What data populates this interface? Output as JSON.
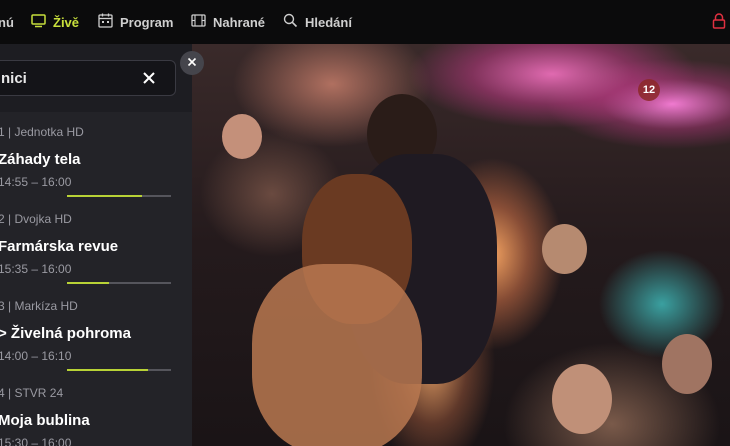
{
  "nav": {
    "items": [
      {
        "label": "nú",
        "icon": "menu-icon",
        "active": false
      },
      {
        "label": "Živě",
        "icon": "tv-icon",
        "active": true
      },
      {
        "label": "Program",
        "icon": "calendar-icon",
        "active": false
      },
      {
        "label": "Nahrané",
        "icon": "film-icon",
        "active": false
      },
      {
        "label": "Hledání",
        "icon": "search-icon",
        "active": false
      }
    ],
    "lock_icon": "lock-icon"
  },
  "search": {
    "value": "nici",
    "clear_icon": "close-icon"
  },
  "close_icon": "close-icon",
  "channels": [
    {
      "channel": "1 | Jednotka HD",
      "title": "Záhady tela",
      "time": "14:55 – 16:00",
      "progress": 0.72
    },
    {
      "channel": "2 | Dvojka HD",
      "title": "Farmárska revue",
      "time": "15:35 – 16:00",
      "progress": 0.4
    },
    {
      "channel": "3 | Markíza HD",
      "title": "> Živelná pohroma",
      "time": "14:00 – 16:10",
      "progress": 0.78
    },
    {
      "channel": "4 | STVR 24",
      "title": "Moja bublina",
      "time": "15:30 – 16:00",
      "progress": 0.5
    }
  ],
  "player": {
    "age_rating": "12"
  },
  "colors": {
    "accent": "#c8e03c",
    "lock": "#e03040",
    "progress": "#b8d236"
  }
}
